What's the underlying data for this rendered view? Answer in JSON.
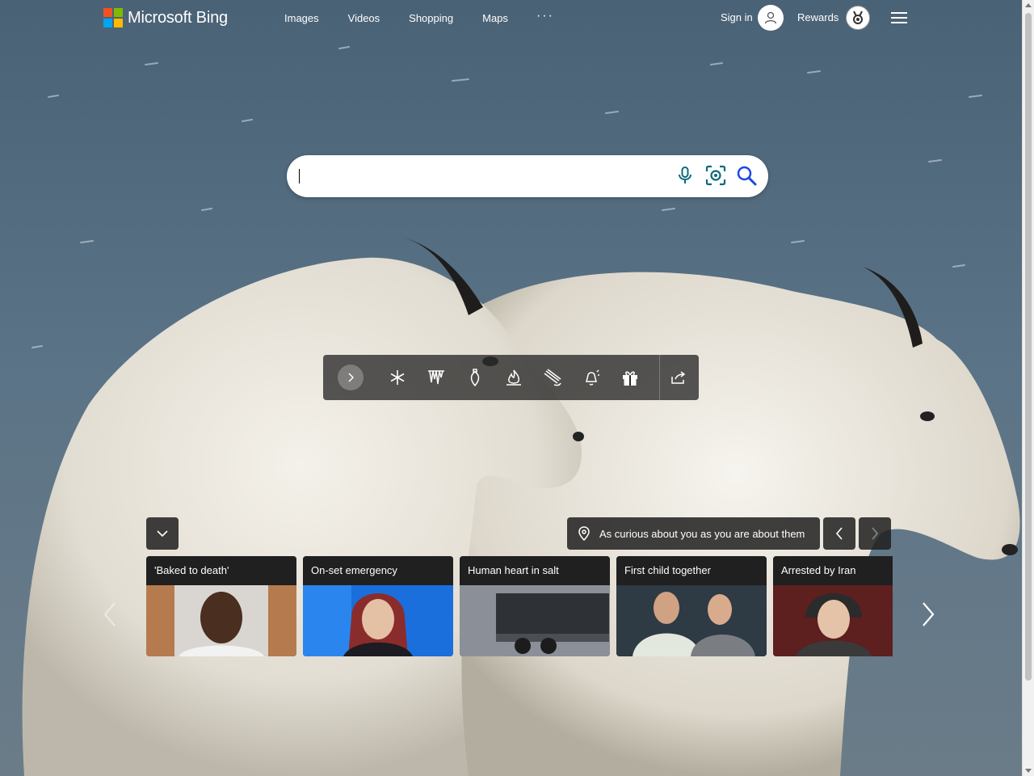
{
  "header": {
    "logo_text": "Microsoft Bing",
    "nav": [
      "Images",
      "Videos",
      "Shopping",
      "Maps"
    ],
    "more": "···",
    "sign_in": "Sign in",
    "rewards": "Rewards"
  },
  "search": {
    "value": "",
    "placeholder": ""
  },
  "toolbar": {
    "icons": [
      "chevron-right-icon",
      "snowflake-icon",
      "icicles-icon",
      "ornament-icon",
      "fire-icon",
      "sled-icon",
      "bell-icon",
      "gift-icon",
      "share-icon"
    ]
  },
  "news": {
    "tagline": "As curious about you as you are about them",
    "cards": [
      {
        "title": "'Baked to death'"
      },
      {
        "title": "On-set emergency"
      },
      {
        "title": "Human heart in salt"
      },
      {
        "title": "First child together"
      },
      {
        "title": "Arrested by Iran"
      }
    ]
  },
  "colors": {
    "ms_red": "#f25022",
    "ms_green": "#7fba00",
    "ms_blue": "#00a4ef",
    "ms_yellow": "#ffb900",
    "search_icon_blue": "#174ae4",
    "teal": "#0a6b7c"
  }
}
